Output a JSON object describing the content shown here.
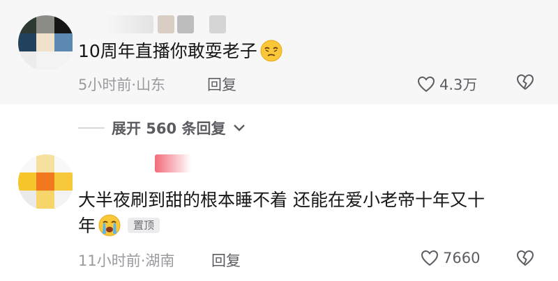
{
  "comments": [
    {
      "text": "10周年直播你敢耍老子",
      "emoji": "smirk-emoji",
      "time": "5小时前",
      "dot": "·",
      "location": "山东",
      "reply_label": "回复",
      "likes": "4.3万"
    },
    {
      "text_line1": "大半夜刷到甜的根本睡不着 还能在爱小老帝十年又十",
      "text_line2": "年",
      "emoji": "crying-emoji",
      "pin_label": "置顶",
      "time": "11小时前",
      "dot": "·",
      "location": "湖南",
      "reply_label": "回复",
      "likes": "7660"
    }
  ],
  "expand": {
    "label": "展开 560 条回复"
  },
  "colors": {
    "text": "#161616",
    "meta": "#9a9a9f",
    "band": "#f7f7f8"
  }
}
